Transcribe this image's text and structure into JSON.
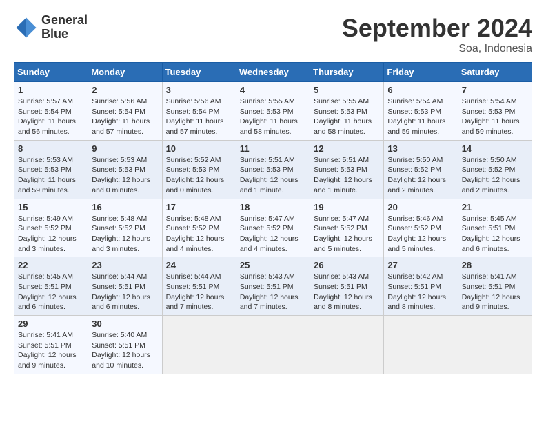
{
  "header": {
    "logo_line1": "General",
    "logo_line2": "Blue",
    "month": "September 2024",
    "location": "Soa, Indonesia"
  },
  "days_of_week": [
    "Sunday",
    "Monday",
    "Tuesday",
    "Wednesday",
    "Thursday",
    "Friday",
    "Saturday"
  ],
  "weeks": [
    [
      {
        "day": "1",
        "sunrise": "5:57 AM",
        "sunset": "5:54 PM",
        "daylight": "11 hours and 56 minutes."
      },
      {
        "day": "2",
        "sunrise": "5:56 AM",
        "sunset": "5:54 PM",
        "daylight": "11 hours and 57 minutes."
      },
      {
        "day": "3",
        "sunrise": "5:56 AM",
        "sunset": "5:54 PM",
        "daylight": "11 hours and 57 minutes."
      },
      {
        "day": "4",
        "sunrise": "5:55 AM",
        "sunset": "5:53 PM",
        "daylight": "11 hours and 58 minutes."
      },
      {
        "day": "5",
        "sunrise": "5:55 AM",
        "sunset": "5:53 PM",
        "daylight": "11 hours and 58 minutes."
      },
      {
        "day": "6",
        "sunrise": "5:54 AM",
        "sunset": "5:53 PM",
        "daylight": "11 hours and 59 minutes."
      },
      {
        "day": "7",
        "sunrise": "5:54 AM",
        "sunset": "5:53 PM",
        "daylight": "11 hours and 59 minutes."
      }
    ],
    [
      {
        "day": "8",
        "sunrise": "5:53 AM",
        "sunset": "5:53 PM",
        "daylight": "11 hours and 59 minutes."
      },
      {
        "day": "9",
        "sunrise": "5:53 AM",
        "sunset": "5:53 PM",
        "daylight": "12 hours and 0 minutes."
      },
      {
        "day": "10",
        "sunrise": "5:52 AM",
        "sunset": "5:53 PM",
        "daylight": "12 hours and 0 minutes."
      },
      {
        "day": "11",
        "sunrise": "5:51 AM",
        "sunset": "5:53 PM",
        "daylight": "12 hours and 1 minute."
      },
      {
        "day": "12",
        "sunrise": "5:51 AM",
        "sunset": "5:53 PM",
        "daylight": "12 hours and 1 minute."
      },
      {
        "day": "13",
        "sunrise": "5:50 AM",
        "sunset": "5:52 PM",
        "daylight": "12 hours and 2 minutes."
      },
      {
        "day": "14",
        "sunrise": "5:50 AM",
        "sunset": "5:52 PM",
        "daylight": "12 hours and 2 minutes."
      }
    ],
    [
      {
        "day": "15",
        "sunrise": "5:49 AM",
        "sunset": "5:52 PM",
        "daylight": "12 hours and 3 minutes."
      },
      {
        "day": "16",
        "sunrise": "5:48 AM",
        "sunset": "5:52 PM",
        "daylight": "12 hours and 3 minutes."
      },
      {
        "day": "17",
        "sunrise": "5:48 AM",
        "sunset": "5:52 PM",
        "daylight": "12 hours and 4 minutes."
      },
      {
        "day": "18",
        "sunrise": "5:47 AM",
        "sunset": "5:52 PM",
        "daylight": "12 hours and 4 minutes."
      },
      {
        "day": "19",
        "sunrise": "5:47 AM",
        "sunset": "5:52 PM",
        "daylight": "12 hours and 5 minutes."
      },
      {
        "day": "20",
        "sunrise": "5:46 AM",
        "sunset": "5:52 PM",
        "daylight": "12 hours and 5 minutes."
      },
      {
        "day": "21",
        "sunrise": "5:45 AM",
        "sunset": "5:51 PM",
        "daylight": "12 hours and 6 minutes."
      }
    ],
    [
      {
        "day": "22",
        "sunrise": "5:45 AM",
        "sunset": "5:51 PM",
        "daylight": "12 hours and 6 minutes."
      },
      {
        "day": "23",
        "sunrise": "5:44 AM",
        "sunset": "5:51 PM",
        "daylight": "12 hours and 6 minutes."
      },
      {
        "day": "24",
        "sunrise": "5:44 AM",
        "sunset": "5:51 PM",
        "daylight": "12 hours and 7 minutes."
      },
      {
        "day": "25",
        "sunrise": "5:43 AM",
        "sunset": "5:51 PM",
        "daylight": "12 hours and 7 minutes."
      },
      {
        "day": "26",
        "sunrise": "5:43 AM",
        "sunset": "5:51 PM",
        "daylight": "12 hours and 8 minutes."
      },
      {
        "day": "27",
        "sunrise": "5:42 AM",
        "sunset": "5:51 PM",
        "daylight": "12 hours and 8 minutes."
      },
      {
        "day": "28",
        "sunrise": "5:41 AM",
        "sunset": "5:51 PM",
        "daylight": "12 hours and 9 minutes."
      }
    ],
    [
      {
        "day": "29",
        "sunrise": "5:41 AM",
        "sunset": "5:51 PM",
        "daylight": "12 hours and 9 minutes."
      },
      {
        "day": "30",
        "sunrise": "5:40 AM",
        "sunset": "5:51 PM",
        "daylight": "12 hours and 10 minutes."
      },
      null,
      null,
      null,
      null,
      null
    ]
  ]
}
